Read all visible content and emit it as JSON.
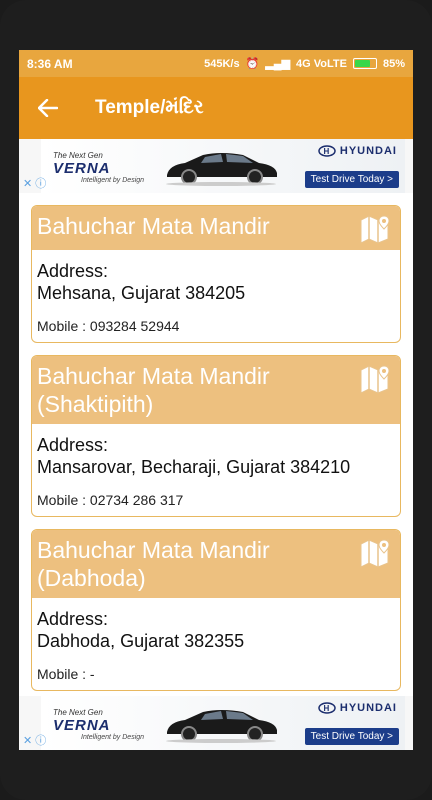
{
  "status": {
    "time": "8:36 AM",
    "speed": "545K/s",
    "network": "4G VoLTE",
    "battery": "85%",
    "battery_level": 0.85
  },
  "appbar": {
    "title": "Temple/મંદિર"
  },
  "ad": {
    "tagline_top": "The Next Gen",
    "model": "VERNA",
    "tagline_bottom": "Intelligent by Design",
    "brand": "HYUNDAI",
    "cta": "Test Drive Today >"
  },
  "temples": [
    {
      "name": "Bahuchar Mata Mandir",
      "address_label": "Address:",
      "address": "Mehsana, Gujarat 384205",
      "mobile": "Mobile : 093284 52944"
    },
    {
      "name": "Bahuchar Mata Mandir (Shaktipith)",
      "address_label": "Address:",
      "address": "Mansarovar, Becharaji, Gujarat 384210",
      "mobile": "Mobile : 02734 286 317"
    },
    {
      "name": "Bahuchar Mata Mandir (Dabhoda)",
      "address_label": "Address:",
      "address": "Dabhoda, Gujarat 382355",
      "mobile": "Mobile : -"
    }
  ],
  "colors": {
    "appbar": "#e8961e",
    "statusbar": "#e8a63e",
    "card_header": "#edc07f"
  }
}
